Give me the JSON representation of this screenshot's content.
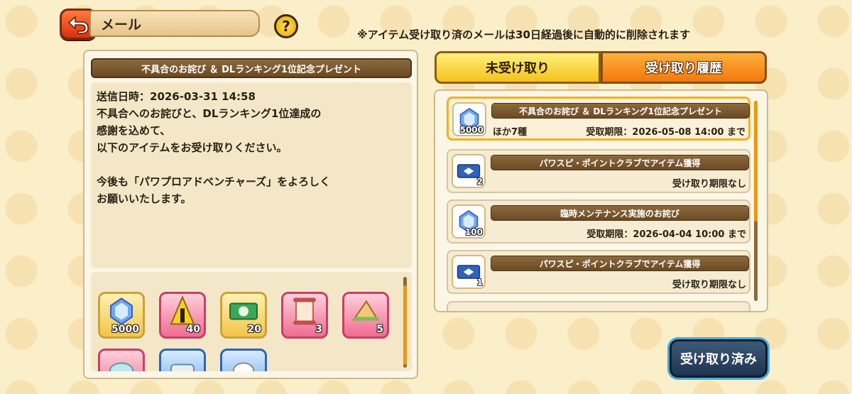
{
  "header": {
    "title": "メール",
    "help_label": "?"
  },
  "notice": "※アイテム受け取り済のメールは30日経過後に自動的に削除されます",
  "detail": {
    "title": "不具合のお詫び ＆ DLランキング1位記念プレゼント",
    "lines": [
      "送信日時：2026-03-31 14:58",
      "不具合へのお詫びと、DLランキング1位達成の",
      "感謝を込めて、",
      "以下のアイテムをお受け取りください。",
      "",
      "今後も「パワプロアドベンチャーズ」をよろしく",
      "お願いいたします。"
    ],
    "items": [
      {
        "icon": "crystal-icon",
        "qty": "5000",
        "frame": "yellow"
      },
      {
        "icon": "golden-mask-icon",
        "qty": "40",
        "frame": "pink"
      },
      {
        "icon": "ticket-icon",
        "qty": "20",
        "frame": "yellow"
      },
      {
        "icon": "scroll-icon",
        "qty": "3",
        "frame": "pink"
      },
      {
        "icon": "sandwich-icon",
        "qty": "5",
        "frame": "pink"
      },
      {
        "icon": "food-icon",
        "qty": "",
        "frame": "pink"
      },
      {
        "icon": "bandage-icon",
        "qty": "",
        "frame": "blue"
      },
      {
        "icon": "glove-icon",
        "qty": "",
        "frame": "blue"
      }
    ]
  },
  "tabs": {
    "unreceived": "未受け取り",
    "history": "受け取り履歴"
  },
  "mails": [
    {
      "title": "不具合のお詫び ＆ DLランキング1位記念プレゼント",
      "icon": "crystal-icon",
      "qty": "5000",
      "other": "ほか7種",
      "expiry": "受取期限：2026-05-08 14:00 まで",
      "selected": true
    },
    {
      "title": "パワスピ・ポイントクラブでアイテム獲得",
      "icon": "ticket-icon",
      "qty": "2",
      "other": "",
      "expiry": "受け取り期限なし",
      "selected": false
    },
    {
      "title": "臨時メンテナンス実施のお詫び",
      "icon": "crystal-icon",
      "qty": "100",
      "other": "",
      "expiry": "受取期限：2026-04-04 10:00 まで",
      "selected": false
    },
    {
      "title": "パワスピ・ポイントクラブでアイテム獲得",
      "icon": "ticket-icon",
      "qty": "1",
      "other": "",
      "expiry": "受け取り期限なし",
      "selected": false
    }
  ],
  "received_button": "受け取り済み"
}
